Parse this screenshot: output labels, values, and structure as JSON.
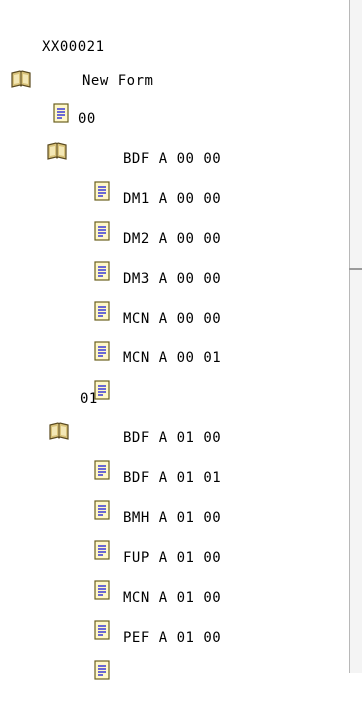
{
  "tree": {
    "root": {
      "label": "XX00021",
      "icon": "open-book-icon"
    },
    "items": [
      {
        "label": "New Form",
        "icon": "document-icon"
      },
      {
        "label": "00",
        "icon": "open-book-icon"
      },
      {
        "label": "BDF A 00 00",
        "icon": "document-icon"
      },
      {
        "label": "DM1 A 00 00",
        "icon": "document-icon"
      },
      {
        "label": "DM2 A 00 00",
        "icon": "document-icon"
      },
      {
        "label": "DM3 A 00 00",
        "icon": "document-icon"
      },
      {
        "label": "MCN A 00 00",
        "icon": "document-icon"
      },
      {
        "label": "MCN A 00 01",
        "icon": "document-icon"
      },
      {
        "label": "01",
        "icon": "open-book-icon"
      },
      {
        "label": "BDF A 01 00",
        "icon": "document-icon"
      },
      {
        "label": "BDF A 01 01",
        "icon": "document-icon"
      },
      {
        "label": "BMH A 01 00",
        "icon": "document-icon"
      },
      {
        "label": "FUP A 01 00",
        "icon": "document-icon"
      },
      {
        "label": "MCN A 01 00",
        "icon": "document-icon"
      },
      {
        "label": "PEF A 01 00",
        "icon": "document-icon"
      }
    ]
  },
  "colors": {
    "book_cover": "#d8c27a",
    "book_outline": "#5a4a20",
    "document_fill": "#fff8c8",
    "document_outline": "#6b6020",
    "document_lines": "#2b2bd8"
  }
}
